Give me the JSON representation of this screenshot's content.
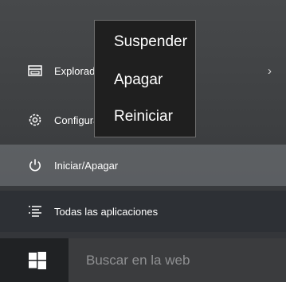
{
  "start_menu": {
    "items": [
      {
        "label": "Explorador de archivos",
        "icon": "file-explorer-icon"
      },
      {
        "label": "Configuración",
        "icon": "gear-icon"
      },
      {
        "label": "Iniciar/Apagar",
        "icon": "power-icon"
      },
      {
        "label": "Todas las aplicaciones",
        "icon": "all-apps-icon"
      }
    ],
    "power_submenu": {
      "options": [
        "Suspender",
        "Apagar",
        "Reiniciar"
      ]
    },
    "explorer_chevron": "›"
  },
  "taskbar": {
    "start_icon": "windows-logo-icon",
    "search_placeholder": "Buscar en la web"
  },
  "colors": {
    "submenu_bg": "#1f1f1f",
    "highlight": "#787c80",
    "text": "#ffffff",
    "taskbar": "#202224"
  }
}
